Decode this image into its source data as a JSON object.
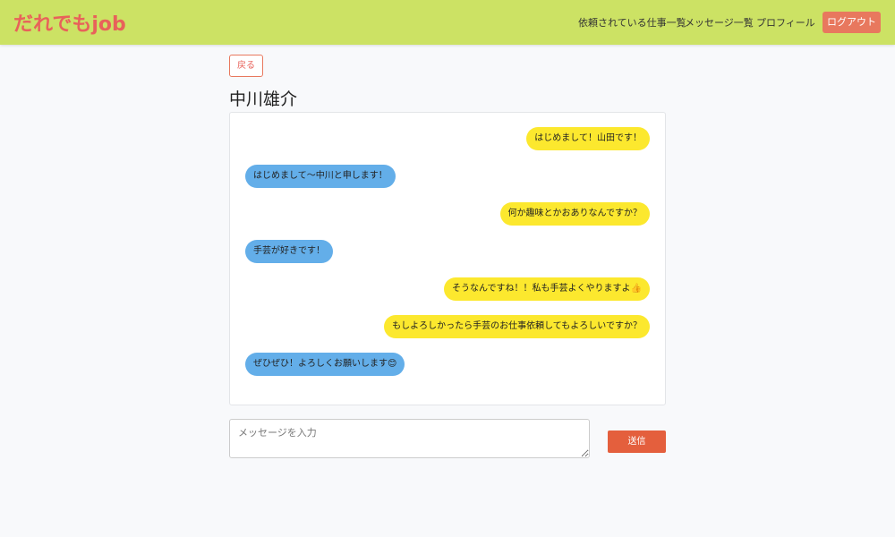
{
  "header": {
    "brand": "だれでもjob",
    "nav": [
      {
        "label": "依頼されている仕事一覧"
      },
      {
        "label": "メッセージ一覧"
      },
      {
        "label": "プロフィール"
      }
    ],
    "logout_label": "ログアウト"
  },
  "back_label": "戻る",
  "partner_name": "中川雄介",
  "messages": [
    {
      "from": "me",
      "text": "はじめまして！山田です！"
    },
    {
      "from": "partner",
      "text": "はじめまして〜中川と申します！"
    },
    {
      "from": "me",
      "text": "何か趣味とかおありなんですか？"
    },
    {
      "from": "partner",
      "text": "手芸が好きです！"
    },
    {
      "from": "me",
      "text": "そうなんですね！！私も手芸よくやりますよ👍"
    },
    {
      "from": "me",
      "text": "もしよろしかったら手芸のお仕事依頼してもよろしいですか？"
    },
    {
      "from": "partner",
      "text": "ぜひぜひ！よろしくお願いします😊"
    }
  ],
  "composer": {
    "placeholder": "メッセージを入力",
    "value": "",
    "send_label": "送信"
  },
  "colors": {
    "header_bg": "#cce264",
    "brand": "#e8625a",
    "my_bubble": "#fce82e",
    "partner_bubble": "#63aee9",
    "send_button": "#e45f3d"
  }
}
